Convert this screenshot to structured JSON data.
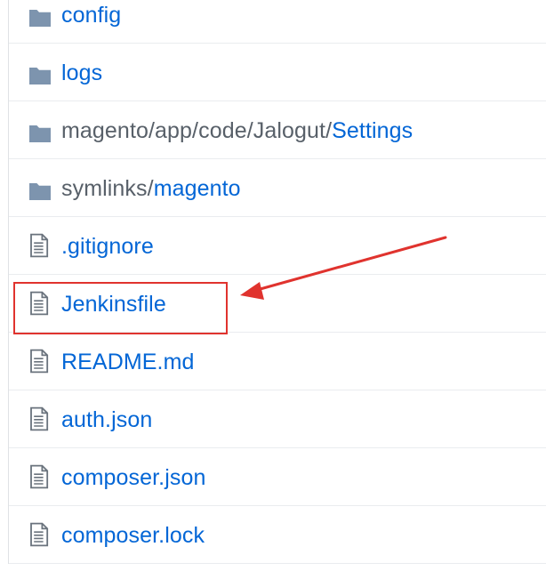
{
  "rows": [
    {
      "type": "folder",
      "icon": "folder-icon",
      "prefix": "",
      "label": "config"
    },
    {
      "type": "folder",
      "icon": "folder-icon",
      "prefix": "",
      "label": "logs"
    },
    {
      "type": "folder",
      "icon": "folder-icon",
      "prefix": "magento/app/code/Jalogut/",
      "label": "Settings"
    },
    {
      "type": "folder",
      "icon": "folder-icon",
      "prefix": "symlinks/",
      "label": "magento"
    },
    {
      "type": "file",
      "icon": "file-text-icon",
      "prefix": "",
      "label": ".gitignore"
    },
    {
      "type": "file",
      "icon": "file-text-icon",
      "prefix": "",
      "label": "Jenkinsfile"
    },
    {
      "type": "file",
      "icon": "file-text-icon",
      "prefix": "",
      "label": "README.md"
    },
    {
      "type": "file",
      "icon": "file-text-icon",
      "prefix": "",
      "label": "auth.json"
    },
    {
      "type": "file",
      "icon": "file-text-icon",
      "prefix": "",
      "label": "composer.json"
    },
    {
      "type": "file",
      "icon": "file-text-icon",
      "prefix": "",
      "label": "composer.lock"
    }
  ],
  "colors": {
    "link": "#0366d6",
    "muted": "#586069",
    "icon": "#6a737d",
    "annotation": "#e0332e"
  }
}
